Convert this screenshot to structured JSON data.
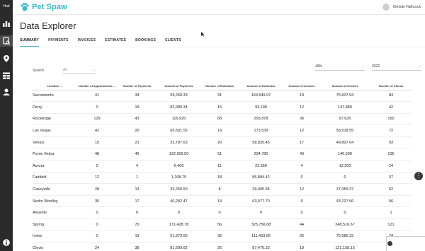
{
  "rail": {
    "hub_label": "Hub",
    "icons": [
      "bar-chart-icon",
      "document-search-icon",
      "location-icon",
      "table-icon",
      "user-icon",
      "info-icon"
    ]
  },
  "header": {
    "brand": "Pet Spaw",
    "user_name": "Christie Hathcock"
  },
  "page": {
    "title": "Data Explorer"
  },
  "tabs": [
    "SUMMARY",
    "PAYMENTS",
    "INVOICES",
    "ESTIMATES",
    "BOOKINGS",
    "CLIENTS"
  ],
  "filters": {
    "search_label": "Search",
    "search_value": "All",
    "month": "JAN",
    "year": "2022"
  },
  "table": {
    "headers": [
      "Location",
      "Number of Appointments",
      "Number of Payments",
      "Amount of Payments",
      "Number of Estimates",
      "Amount of Estimates",
      "Number of Invoices",
      "Amount of Invoices",
      "Number of Clients"
    ],
    "rows": [
      [
        "Sacramento",
        "41",
        "34",
        "59,250.33",
        "31",
        "169,649.97",
        "19",
        "75,607.94",
        "84"
      ],
      [
        "Derry",
        "0",
        "19",
        "82,089.34",
        "15",
        "93,190",
        "12",
        "147,880",
        "42"
      ],
      [
        "Rockledge",
        "129",
        "43",
        "116,925",
        "83",
        "293,878",
        "36",
        "97,625",
        "150"
      ],
      [
        "Las Vegas",
        "42",
        "20",
        "65,591.55",
        "18",
        "173,539",
        "12",
        "56,518.55",
        "72"
      ],
      [
        "Venice",
        "15",
        "21",
        "33,797.63",
        "20",
        "58,835.45",
        "17",
        "49,807.04",
        "93"
      ],
      [
        "Ponte Vedra",
        "48",
        "46",
        "132,509.50",
        "51",
        "294,780",
        "40",
        "146,500",
        "105"
      ],
      [
        "Aurora",
        "0",
        "4",
        "6,400",
        "11",
        "23,660",
        "4",
        "12,200",
        "24"
      ],
      [
        "Fairfield",
        "12",
        "1",
        "1,168.75",
        "18",
        "85,884.42",
        "0",
        "0",
        "37"
      ],
      [
        "Caseyville",
        "28",
        "13",
        "33,250.50",
        "8",
        "39,995.95",
        "12",
        "37,059.37",
        "52"
      ],
      [
        "Sedro Woolley",
        "30",
        "17",
        "40,282.47",
        "14",
        "63,977.70",
        "9",
        "43,707.66",
        "56"
      ],
      [
        "Amarillo",
        "0",
        "0",
        "0",
        "0",
        "0",
        "0",
        "0",
        "1"
      ],
      [
        "Spring",
        "0",
        "70",
        "171,428.78",
        "56",
        "325,756.68",
        "44",
        "248,516.67",
        "121"
      ],
      [
        "Irvine",
        "0",
        "19",
        "51,973.65",
        "36",
        "111,433.66",
        "25",
        "75,580.33",
        "74"
      ],
      [
        "Clovis",
        "24",
        "38",
        "81,609.62",
        "26",
        "87,476.23",
        "19",
        "121,158.15",
        "129"
      ]
    ]
  }
}
